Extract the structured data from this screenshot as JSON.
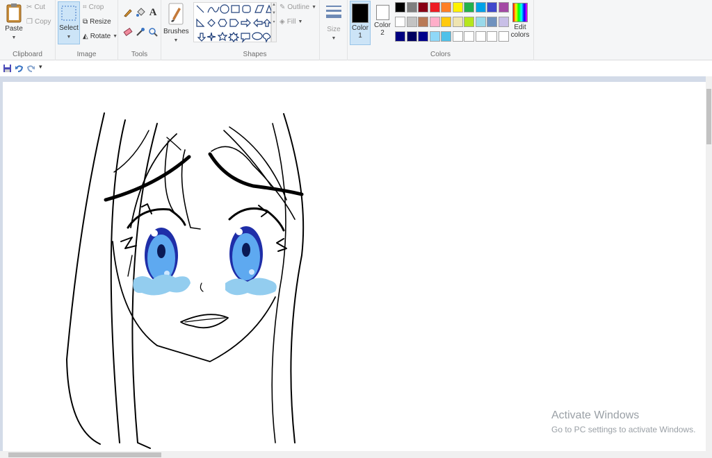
{
  "clipboard": {
    "paste": "Paste",
    "cut": "Cut",
    "copy": "Copy",
    "group": "Clipboard"
  },
  "image": {
    "select": "Select",
    "crop": "Crop",
    "resize": "Resize",
    "rotate": "Rotate",
    "group": "Image"
  },
  "tools": {
    "group": "Tools",
    "text_tool": "A"
  },
  "brushes": {
    "label": "Brushes"
  },
  "shapes": {
    "outline": "Outline",
    "fill": "Fill",
    "group": "Shapes"
  },
  "size": {
    "label": "Size"
  },
  "colors": {
    "color1_label": "Color",
    "color1_num": "1",
    "color2_label": "Color",
    "color2_num": "2",
    "color1_value": "#000000",
    "color2_value": "#ffffff",
    "edit_label": "Edit",
    "edit_label2": "colors",
    "group": "Colors",
    "palette": [
      "#000000",
      "#7f7f7f",
      "#880015",
      "#ed1c24",
      "#ff7f27",
      "#fff200",
      "#22b14c",
      "#00a2e8",
      "#3f48cc",
      "#a349a4",
      "#ffffff",
      "#c3c3c3",
      "#b97a57",
      "#ffaec9",
      "#ffc90e",
      "#efe4b0",
      "#b5e61d",
      "#99d9ea",
      "#7092be",
      "#c8bfe7",
      "#000080",
      "#000060",
      "#00008b",
      "#8fd8f8",
      "#4fc1e9",
      "#ffffff",
      "#ffffff",
      "#ffffff",
      "#ffffff",
      "#ffffff"
    ]
  },
  "watermark": {
    "title": "Activate Windows",
    "subtitle": "Go to PC settings to activate Windows."
  }
}
